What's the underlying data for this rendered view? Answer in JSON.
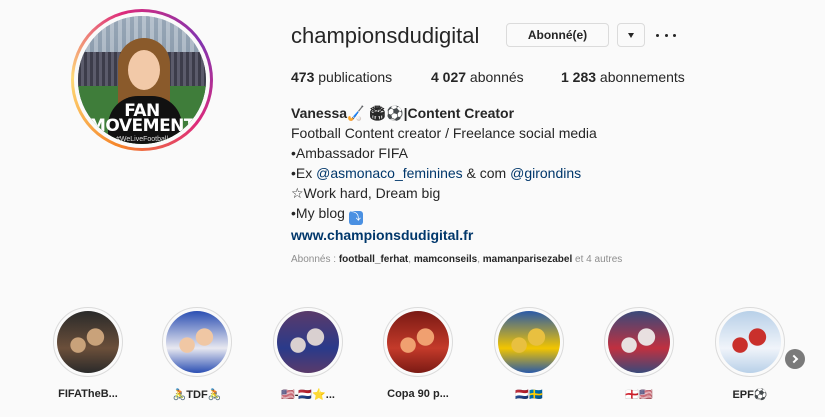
{
  "profile": {
    "username": "championsdudigital",
    "follow_label": "Abonné(e)",
    "avatar_text": "FAN MOVEMENT",
    "avatar_subtext": "#WeLiveFootball"
  },
  "stats": {
    "posts_count": "473",
    "posts_label": " publications",
    "followers_count": "4 027",
    "followers_label": " abonnés",
    "following_count": "1 283",
    "following_label": " abonnements"
  },
  "bio": {
    "name": "Vanessa🏑 🏟⚽|Content Creator",
    "line1": "Football Content creator / Freelance social media",
    "line2": "•Ambassador FIFA",
    "line3_prefix": "•Ex ",
    "line3_mention1": "@asmonaco_feminines",
    "line3_mid": " & com ",
    "line3_mention2": "@girondins",
    "line4": "☆Work hard, Dream big",
    "line5": "•My blog ",
    "line5_emoji": "⤵",
    "website": "www.championsdudigital.fr"
  },
  "followed_by": {
    "prefix": "Abonnés : ",
    "user1": "football_ferhat",
    "sep1": ", ",
    "user2": "mamconseils",
    "sep2": ", ",
    "user3": "mamanparisezabel",
    "suffix": " et 4 autres"
  },
  "highlights": [
    {
      "label": "FIFATheB...",
      "colors": [
        "#2a2a2a",
        "#6b4f3a",
        "#c9a27a"
      ]
    },
    {
      "label": "🚴TDF🚴",
      "colors": [
        "#2b4fb3",
        "#e8e8f0",
        "#f0c7a4"
      ]
    },
    {
      "label": "🇺🇸-🇳🇱⭐...",
      "colors": [
        "#5a3a6a",
        "#2a3a8a",
        "#d9d0d0"
      ]
    },
    {
      "label": "Copa 90 p...",
      "colors": [
        "#7a1a14",
        "#c43a2a",
        "#f0a070"
      ]
    },
    {
      "label": "🇳🇱🇸🇪",
      "colors": [
        "#2a5aa8",
        "#f2c500",
        "#e8c040"
      ]
    },
    {
      "label": "🏴󠁧󠁢󠁥󠁮󠁧󠁿🇺🇸",
      "colors": [
        "#3a4a7a",
        "#c03040",
        "#e8e0e0"
      ]
    },
    {
      "label": "EPF⚽",
      "colors": [
        "#b8d0e8",
        "#f0f4fa",
        "#c9302c"
      ]
    }
  ]
}
